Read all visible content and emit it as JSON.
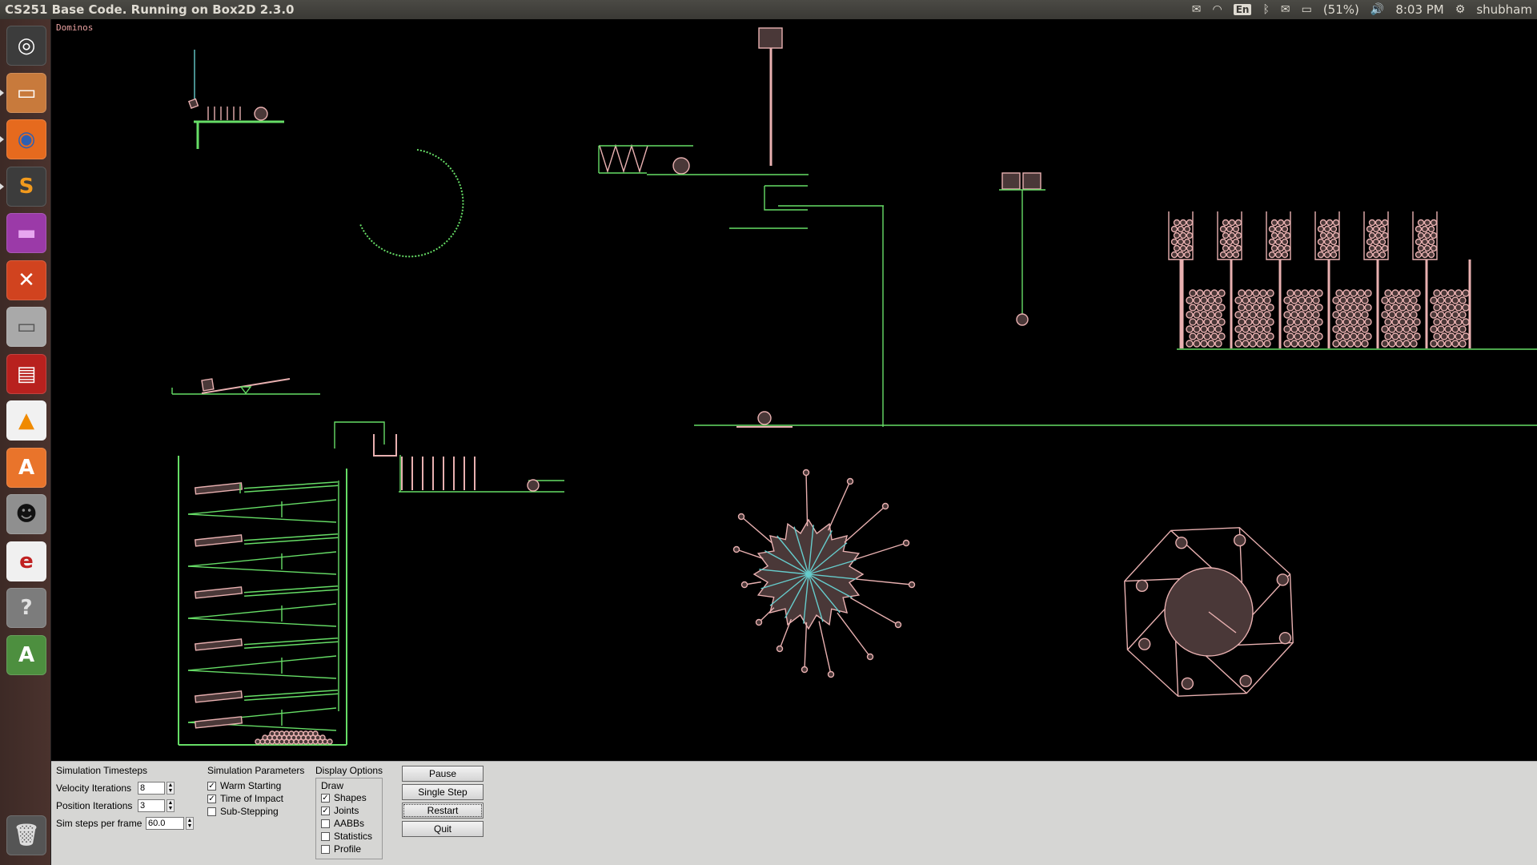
{
  "window": {
    "title": "CS251 Base Code. Running on Box2D 2.3.0"
  },
  "topbar": {
    "keyboard": "En",
    "battery": "(51%)",
    "time": "8:03 PM",
    "user": "shubham"
  },
  "launcher": {
    "items": [
      {
        "name": "ubuntu-dash",
        "glyph": "◎",
        "bg": "#3c3c3c",
        "fg": "#fff"
      },
      {
        "name": "files",
        "glyph": "▭",
        "bg": "#c87a3c",
        "fg": "#fff"
      },
      {
        "name": "firefox",
        "glyph": "◉",
        "bg": "#e66a1e",
        "fg": "#2e5fb3"
      },
      {
        "name": "sublime-text",
        "glyph": "S",
        "bg": "#3c3c3c",
        "fg": "#f29a1d"
      },
      {
        "name": "workspace-switcher",
        "glyph": "▬",
        "bg": "#9b3aa8",
        "fg": "#e7a6f0"
      },
      {
        "name": "system-settings",
        "glyph": "✕",
        "bg": "#d1431f",
        "fg": "#fff"
      },
      {
        "name": "disk",
        "glyph": "▭",
        "bg": "#a9a9a9",
        "fg": "#555"
      },
      {
        "name": "terminal-app",
        "glyph": "▤",
        "bg": "#b8211e",
        "fg": "#fff"
      },
      {
        "name": "vlc",
        "glyph": "▲",
        "bg": "#f1f1f1",
        "fg": "#f08a00"
      },
      {
        "name": "software-center",
        "glyph": "A",
        "bg": "#e9742b",
        "fg": "#fff"
      },
      {
        "name": "tux-app",
        "glyph": "☻",
        "bg": "#8f8f8f",
        "fg": "#111"
      },
      {
        "name": "document-viewer",
        "glyph": "e",
        "bg": "#f0f0f0",
        "fg": "#c02020"
      },
      {
        "name": "help",
        "glyph": "?",
        "bg": "#7c7c7c",
        "fg": "#e0e0e0"
      },
      {
        "name": "software-updater",
        "glyph": "A",
        "bg": "#4d8f3f",
        "fg": "#fff"
      }
    ],
    "trash": {
      "name": "trash",
      "glyph": "🗑",
      "bg": "#555",
      "fg": "#ddd"
    }
  },
  "scene": {
    "label": "Dominos"
  },
  "controls": {
    "timesteps": {
      "header": "Simulation Timesteps",
      "velocity_label": "Velocity Iterations",
      "velocity_value": "8",
      "position_label": "Position Iterations",
      "position_value": "3",
      "hz_label": "Sim steps per frame",
      "hz_value": "60.0"
    },
    "params": {
      "header": "Simulation Parameters",
      "items": [
        {
          "label": "Warm Starting",
          "checked": true
        },
        {
          "label": "Time of Impact",
          "checked": true
        },
        {
          "label": "Sub-Stepping",
          "checked": false
        }
      ]
    },
    "display": {
      "header": "Display Options",
      "draw_header": "Draw",
      "items": [
        {
          "label": "Shapes",
          "checked": true
        },
        {
          "label": "Joints",
          "checked": true
        },
        {
          "label": "AABBs",
          "checked": false
        },
        {
          "label": "Statistics",
          "checked": false
        },
        {
          "label": "Profile",
          "checked": false
        }
      ]
    },
    "buttons": {
      "pause": "Pause",
      "single_step": "Single Step",
      "restart": "Restart",
      "quit": "Quit"
    }
  },
  "colors": {
    "static": "#66dd66",
    "dynamic": "#e8b0b0",
    "joint": "#66cccc",
    "fill_dynamic": "#4a3838"
  }
}
